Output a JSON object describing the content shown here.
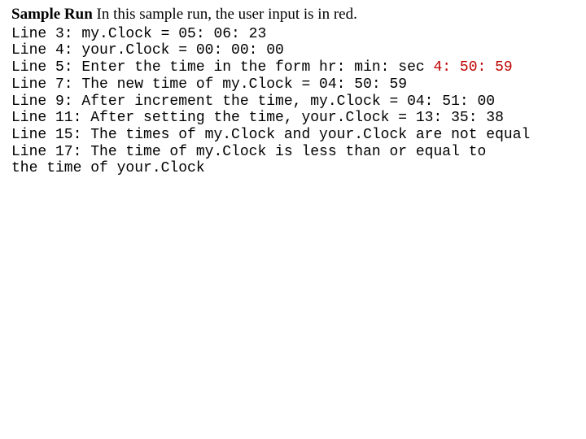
{
  "heading": {
    "bold": "Sample Run",
    "rest": " In this sample run, the user input is in red."
  },
  "lines": {
    "l3": "Line 3: my.Clock = 05: 06: 23",
    "l4": "Line 4: your.Clock = 00: 00: 00",
    "l5a": "Line 5: Enter the time in the form hr: min: sec ",
    "l5b": "4: 50: 59",
    "l7": "Line 7: The new time of my.Clock = 04: 50: 59",
    "l9": "Line 9: After increment the time, my.Clock = 04: 51: 00",
    "l11": "Line 11: After setting the time, your.Clock = 13: 35: 38",
    "l15": "Line 15: The times of my.Clock and your.Clock are not equal",
    "l17a": "Line 17: The time of my.Clock is less than or equal to",
    "l17b": "the time of your.Clock"
  }
}
